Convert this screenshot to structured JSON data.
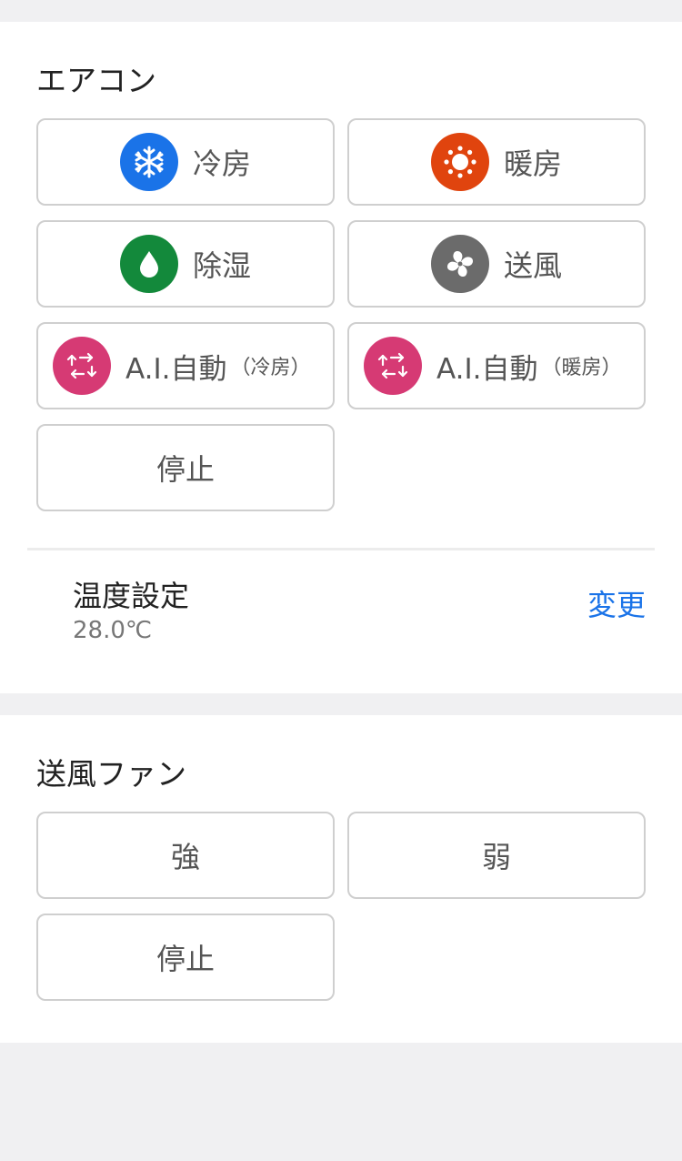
{
  "aircon": {
    "title": "エアコン",
    "buttons": {
      "cool": {
        "label": "冷房",
        "icon": "snowflake-icon",
        "color": "#1a73e8"
      },
      "heat": {
        "label": "暖房",
        "icon": "sun-icon",
        "color": "#e0440e"
      },
      "dry": {
        "label": "除湿",
        "icon": "water-drop-icon",
        "color": "#13893b"
      },
      "fan": {
        "label": "送風",
        "icon": "fan-icon",
        "color": "#6b6b6b"
      },
      "ai_cool": {
        "label": "A.I.自動",
        "sub": "（冷房）",
        "icon": "auto-arrows-icon",
        "color": "#d63a74"
      },
      "ai_heat": {
        "label": "A.I.自動",
        "sub": "（暖房）",
        "icon": "auto-arrows-icon",
        "color": "#d63a74"
      },
      "stop": {
        "label": "停止"
      }
    }
  },
  "temperature": {
    "title": "温度設定",
    "value": "28.0℃",
    "change_label": "変更",
    "link_color": "#1a73e8"
  },
  "fan": {
    "title": "送風ファン",
    "buttons": {
      "strong": {
        "label": "強"
      },
      "weak": {
        "label": "弱"
      },
      "stop": {
        "label": "停止"
      }
    }
  }
}
